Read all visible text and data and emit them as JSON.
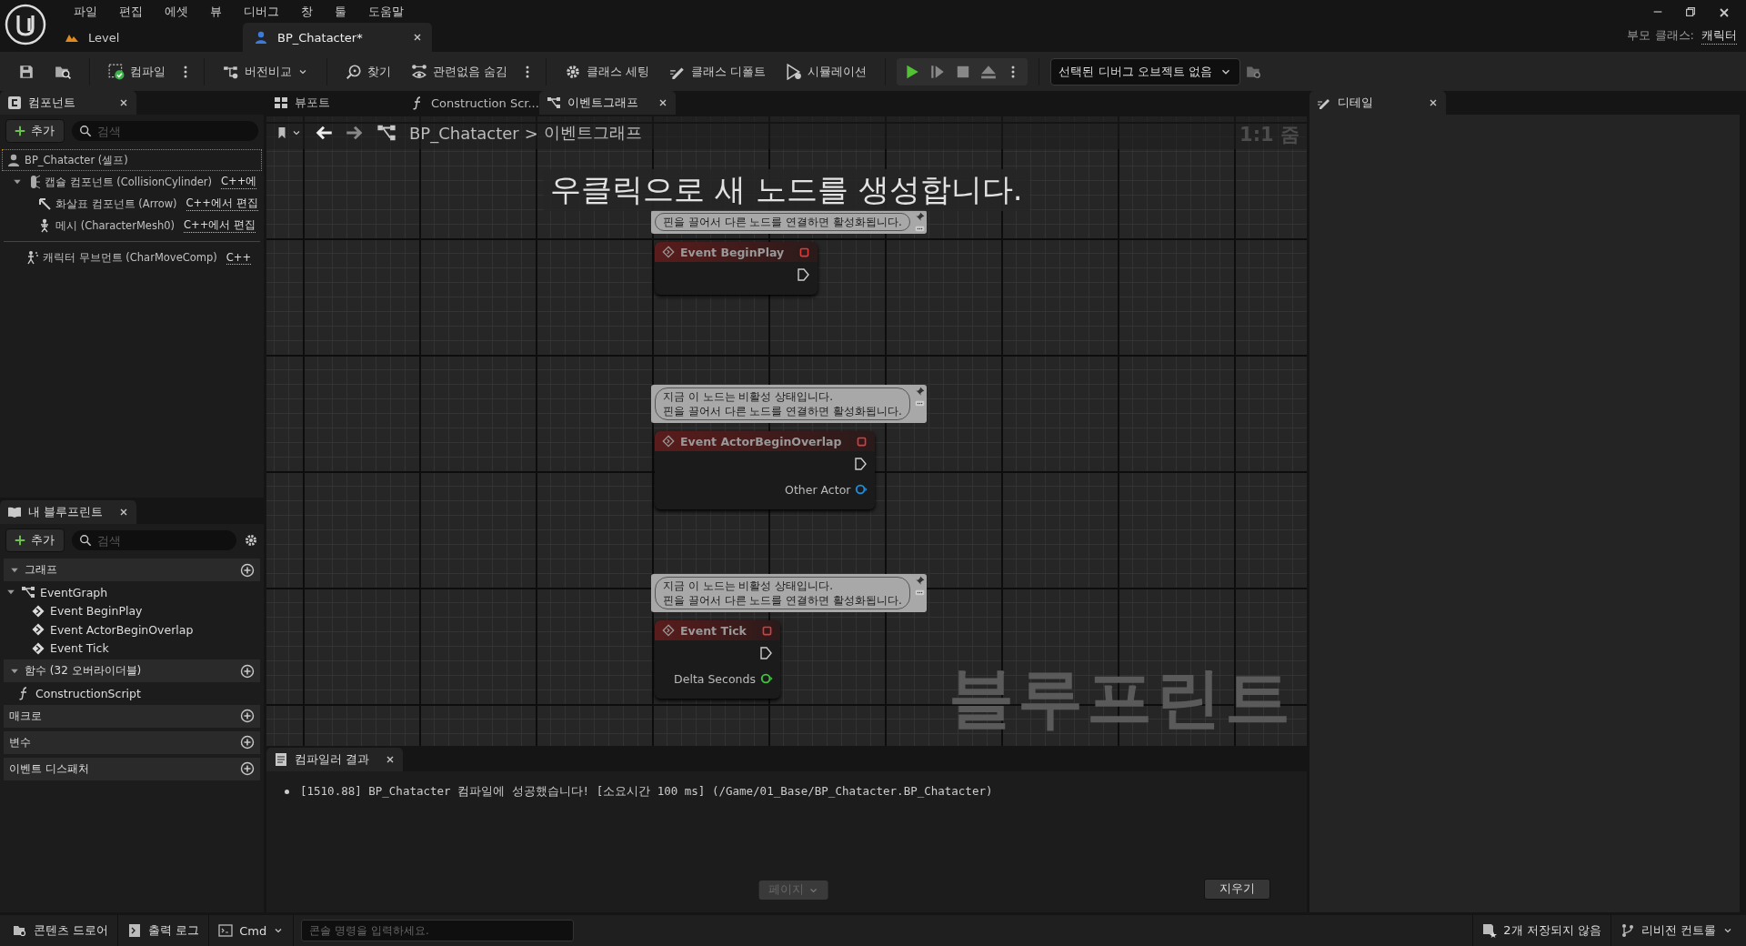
{
  "menu": [
    "파일",
    "편집",
    "에셋",
    "뷰",
    "디버그",
    "창",
    "툴",
    "도움말"
  ],
  "document_tabs": [
    {
      "label": "Level",
      "kind": "level",
      "selected": false
    },
    {
      "label": "BP_Chatacter*",
      "kind": "blueprint",
      "selected": true
    }
  ],
  "parent_class": {
    "label": "부모 클래스:",
    "value": "캐릭터"
  },
  "toolbar": [
    {
      "kind": "save"
    },
    {
      "kind": "browse"
    },
    {
      "kind": "compile",
      "label": "컴파일",
      "more": true
    },
    {
      "kind": "diff",
      "label": "버전비교",
      "dropdown": true
    },
    {
      "kind": "find",
      "label": "찾기"
    },
    {
      "kind": "hide",
      "label": "관련없음 숨김",
      "more": true
    },
    {
      "kind": "class-settings",
      "label": "클래스 세팅"
    },
    {
      "kind": "class-defaults",
      "label": "클래스 디폴트"
    },
    {
      "kind": "simulate",
      "label": "시뮬레이션"
    }
  ],
  "play_controls": [
    {
      "kind": "play"
    },
    {
      "kind": "step"
    },
    {
      "kind": "stop"
    },
    {
      "kind": "eject"
    }
  ],
  "debug_object": {
    "label": "선택된 디버그 오브젝트 없음"
  },
  "components": {
    "tab": "컴포넌트",
    "add": "추가",
    "search_placeholder": "검색",
    "tree": [
      {
        "label": "BP_Chatacter (셀프)",
        "kind": "actor",
        "selected": true,
        "children": [
          {
            "label": "캡슐 컴포넌트 (CollisionCylinder)",
            "link": "C++에",
            "kind": "capsule",
            "selected": false,
            "expanded": true,
            "children": [
              {
                "label": "화살표 컴포넌트 (Arrow)",
                "link": "C++에서 편집",
                "kind": "arrow",
                "selected": false
              },
              {
                "label": "메시 (CharacterMesh0)",
                "link": "C++에서 편집",
                "kind": "mesh",
                "selected": false
              }
            ]
          },
          {
            "label": "캐릭터 무브먼트 (CharMoveComp)",
            "link": "C++",
            "kind": "movement",
            "selected": false
          }
        ]
      }
    ]
  },
  "my_blueprint": {
    "tab": "내 블루프린트",
    "add": "추가",
    "search_placeholder": "검색",
    "sections": [
      {
        "title": "그래프",
        "expanded": true,
        "items": [
          {
            "label": "EventGraph",
            "kind": "graph",
            "expanded": true,
            "children": [
              {
                "label": "Event BeginPlay",
                "kind": "event"
              },
              {
                "label": "Event ActorBeginOverlap",
                "kind": "event"
              },
              {
                "label": "Event Tick",
                "kind": "event"
              }
            ]
          }
        ]
      },
      {
        "title": "함수 (32 오버라이더블)",
        "expanded": true,
        "items": [
          {
            "label": "ConstructionScript",
            "kind": "function"
          }
        ]
      },
      {
        "title": "매크로"
      },
      {
        "title": "변수"
      },
      {
        "title": "이벤트 디스패처"
      }
    ]
  },
  "graph": {
    "tabs": [
      {
        "label": "뷰포트",
        "kind": "viewport",
        "selected": false
      },
      {
        "label": "Construction Scr...",
        "kind": "function",
        "selected": false
      },
      {
        "label": "이벤트그래프",
        "kind": "graph",
        "selected": true
      }
    ],
    "breadcrumb": {
      "root": "BP_Chatacter",
      "separator": ">",
      "current": "이벤트그래프"
    },
    "zoom": "1:1 줌",
    "hint": "우클릭으로 새 노드를 생성합니다.",
    "watermark": "블루프린트",
    "nodes": [
      {
        "title": "Event BeginPlay",
        "comment": [
          "핀을 끌어서 다른 노드를 연결하면 활성화됩니다."
        ],
        "pins": [
          {
            "kind": "exec"
          }
        ]
      },
      {
        "title": "Event ActorBeginOverlap",
        "comment": [
          "지금 이 노드는 비활성 상태입니다.",
          "핀을 끌어서 다른 노드를 연결하면 활성화됩니다."
        ],
        "pins": [
          {
            "kind": "exec"
          },
          {
            "kind": "data",
            "label": "Other Actor",
            "color": "#1e8fd8"
          }
        ]
      },
      {
        "title": "Event Tick",
        "comment": [
          "지금 이 노드는 비활성 상태입니다.",
          "핀을 끌어서 다른 노드를 연결하면 활성화됩니다."
        ],
        "pins": [
          {
            "kind": "exec"
          },
          {
            "kind": "data",
            "label": "Delta Seconds",
            "color": "#3fc43f"
          }
        ]
      }
    ]
  },
  "compiler": {
    "tab": "컴파일러 결과",
    "messages": [
      "[1510.88] BP_Chatacter 컴파일에 성공했습니다! [소요시간 100 ms] (/Game/01_Base/BP_Chatacter.BP_Chatacter)"
    ],
    "page_button": "페이지",
    "clear_button": "지우기"
  },
  "details": {
    "tab": "디테일"
  },
  "status_bar": {
    "content_drawer": "콘텐츠 드로어",
    "output_log": "출력 로그",
    "cmd": "Cmd",
    "console_placeholder": "콘솔 명령을 입력하세요.",
    "unsaved": "2개 저장되지 않음",
    "revision_control": "리비전 컨트롤"
  }
}
